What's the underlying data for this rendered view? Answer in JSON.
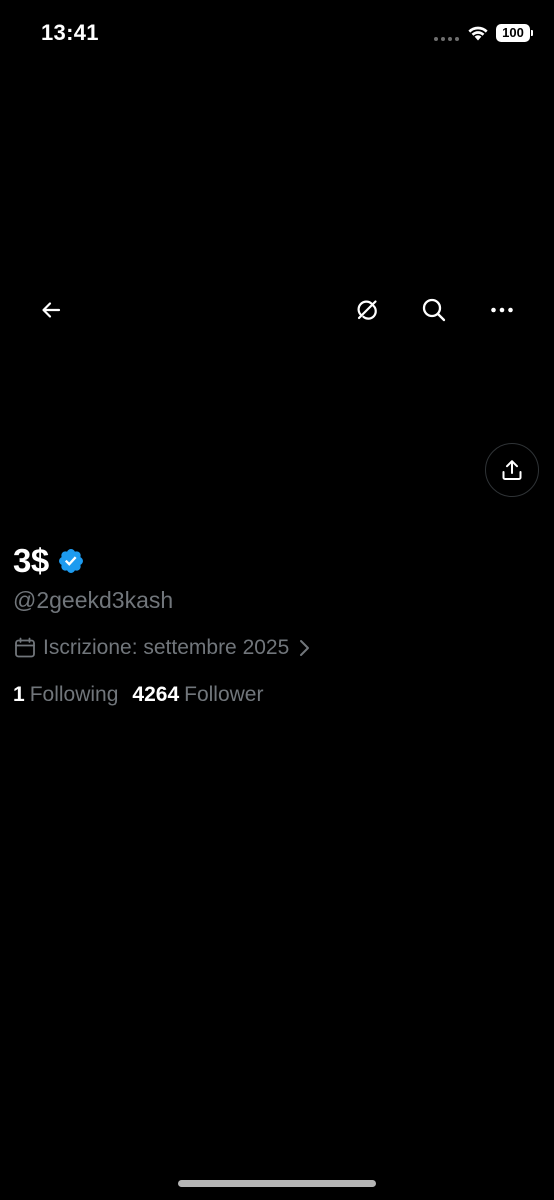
{
  "status_bar": {
    "time": "13:41",
    "battery": "100"
  },
  "nav": {
    "back_icon": "arrow-left-icon",
    "grok_icon": "grok-icon",
    "search_icon": "search-icon",
    "more_icon": "more-horizontal-icon"
  },
  "share": {
    "icon": "share-upload-icon"
  },
  "profile": {
    "display_name": "3$",
    "verified": true,
    "verified_color": "#1d9bf0",
    "handle": "@2geekd3kash",
    "join_label": "Iscrizione: settembre 2025",
    "following_count": "1",
    "following_label": "Following",
    "followers_count": "4264",
    "followers_label": "Follower"
  },
  "colors": {
    "background": "#000000",
    "primary_text": "#ffffff",
    "secondary_text": "#71767b",
    "border": "#2f3336"
  }
}
